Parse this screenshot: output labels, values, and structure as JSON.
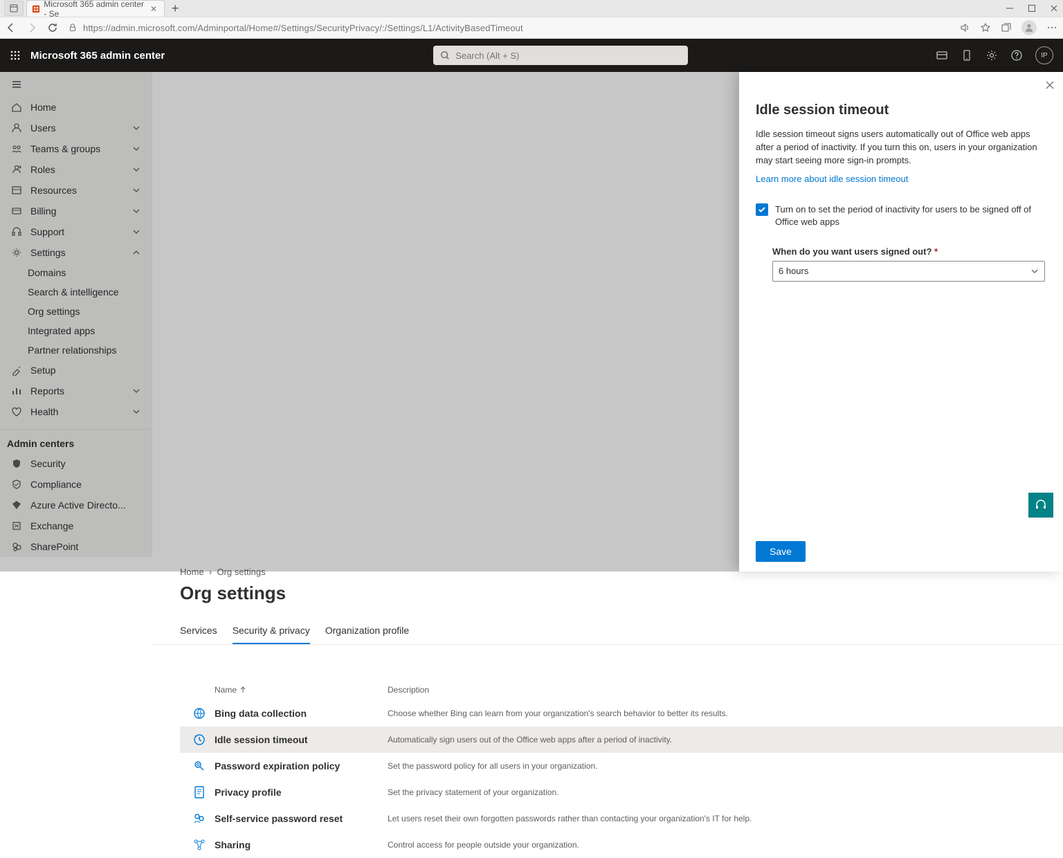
{
  "browser": {
    "tab_title": "Microsoft 365 admin center - Se",
    "url_display": "https://admin.microsoft.com/Adminportal/Home#/Settings/SecurityPrivacy/:/Settings/L1/ActivityBasedTimeout"
  },
  "topnav": {
    "app_title": "Microsoft 365 admin center",
    "search_placeholder": "Search (Alt + S)",
    "avatar_initials": "IP"
  },
  "sidebar": {
    "items": [
      {
        "label": "Home",
        "icon": "home",
        "expandable": false
      },
      {
        "label": "Users",
        "icon": "user",
        "expandable": true
      },
      {
        "label": "Teams & groups",
        "icon": "teams",
        "expandable": true
      },
      {
        "label": "Roles",
        "icon": "roles",
        "expandable": true
      },
      {
        "label": "Resources",
        "icon": "resources",
        "expandable": true
      },
      {
        "label": "Billing",
        "icon": "billing",
        "expandable": true
      },
      {
        "label": "Support",
        "icon": "support",
        "expandable": true
      },
      {
        "label": "Settings",
        "icon": "settings",
        "expandable": true,
        "expanded": true,
        "children": [
          {
            "label": "Domains"
          },
          {
            "label": "Search & intelligence"
          },
          {
            "label": "Org settings"
          },
          {
            "label": "Integrated apps"
          },
          {
            "label": "Partner relationships"
          }
        ]
      },
      {
        "label": "Setup",
        "icon": "setup",
        "expandable": false
      },
      {
        "label": "Reports",
        "icon": "reports",
        "expandable": true
      },
      {
        "label": "Health",
        "icon": "health",
        "expandable": true
      }
    ],
    "admin_centers_header": "Admin centers",
    "admin_centers": [
      {
        "label": "Security",
        "icon": "shield"
      },
      {
        "label": "Compliance",
        "icon": "compliance"
      },
      {
        "label": "Azure Active Directo...",
        "icon": "aad"
      },
      {
        "label": "Exchange",
        "icon": "exchange"
      },
      {
        "label": "SharePoint",
        "icon": "sharepoint"
      }
    ]
  },
  "breadcrumb": {
    "root": "Home",
    "current": "Org settings"
  },
  "page": {
    "title": "Org settings"
  },
  "tabs": [
    {
      "label": "Services"
    },
    {
      "label": "Security & privacy",
      "active": true
    },
    {
      "label": "Organization profile"
    }
  ],
  "table": {
    "columns": {
      "name": "Name",
      "description": "Description"
    },
    "rows": [
      {
        "name": "Bing data collection",
        "description": "Choose whether Bing can learn from your organization's search behavior to better its results."
      },
      {
        "name": "Idle session timeout",
        "description": "Automatically sign users out of the Office web apps after a period of inactivity.",
        "selected": true
      },
      {
        "name": "Password expiration policy",
        "description": "Set the password policy for all users in your organization."
      },
      {
        "name": "Privacy profile",
        "description": "Set the privacy statement of your organization."
      },
      {
        "name": "Self-service password reset",
        "description": "Let users reset their own forgotten passwords rather than contacting your organization's IT for help."
      },
      {
        "name": "Sharing",
        "description": "Control access for people outside your organization."
      }
    ]
  },
  "panel": {
    "title": "Idle session timeout",
    "description": "Idle session timeout signs users automatically out of Office web apps after a period of inactivity. If you turn this on, users in your organization may start seeing more sign-in prompts.",
    "learn_more": "Learn more about idle session timeout",
    "checkbox_label": "Turn on to set the period of inactivity for users to be signed off of Office web apps",
    "field_label": "When do you want users signed out?",
    "select_value": "6 hours",
    "save_label": "Save"
  }
}
